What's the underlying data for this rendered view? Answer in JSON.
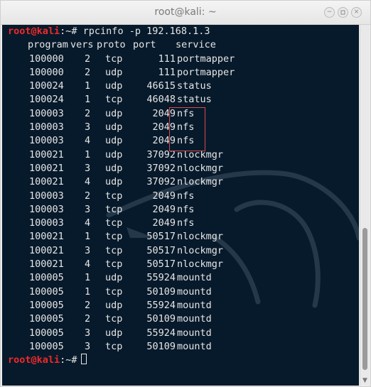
{
  "window": {
    "title": "root@kali: ~",
    "minimize_glyph": "−",
    "close_glyph": "×"
  },
  "terminal": {
    "prompt_user": "root@kali",
    "prompt_suffix": ":~# ",
    "command": "rpcinfo -p 192.168.1.3",
    "header": {
      "program": "program",
      "vers": "vers",
      "proto": "proto",
      "port": "port",
      "service": "service"
    },
    "rows": [
      [
        "100000",
        "2",
        "tcp",
        "111",
        "portmapper"
      ],
      [
        "100000",
        "2",
        "udp",
        "111",
        "portmapper"
      ],
      [
        "100024",
        "1",
        "udp",
        "46615",
        "status"
      ],
      [
        "100024",
        "1",
        "tcp",
        "46048",
        "status"
      ],
      [
        "100003",
        "2",
        "udp",
        "2049",
        "nfs"
      ],
      [
        "100003",
        "3",
        "udp",
        "2049",
        "nfs"
      ],
      [
        "100003",
        "4",
        "udp",
        "2049",
        "nfs"
      ],
      [
        "100021",
        "1",
        "udp",
        "37092",
        "nlockmgr"
      ],
      [
        "100021",
        "3",
        "udp",
        "37092",
        "nlockmgr"
      ],
      [
        "100021",
        "4",
        "udp",
        "37092",
        "nlockmgr"
      ],
      [
        "100003",
        "2",
        "tcp",
        "2049",
        "nfs"
      ],
      [
        "100003",
        "3",
        "tcp",
        "2049",
        "nfs"
      ],
      [
        "100003",
        "4",
        "tcp",
        "2049",
        "nfs"
      ],
      [
        "100021",
        "1",
        "tcp",
        "50517",
        "nlockmgr"
      ],
      [
        "100021",
        "3",
        "tcp",
        "50517",
        "nlockmgr"
      ],
      [
        "100021",
        "4",
        "tcp",
        "50517",
        "nlockmgr"
      ],
      [
        "100005",
        "1",
        "udp",
        "55924",
        "mountd"
      ],
      [
        "100005",
        "1",
        "tcp",
        "50109",
        "mountd"
      ],
      [
        "100005",
        "2",
        "udp",
        "55924",
        "mountd"
      ],
      [
        "100005",
        "2",
        "tcp",
        "50109",
        "mountd"
      ],
      [
        "100005",
        "3",
        "udp",
        "55924",
        "mountd"
      ],
      [
        "100005",
        "3",
        "tcp",
        "50109",
        "mountd"
      ]
    ]
  },
  "colors": {
    "terminal_bg": "#071a2b",
    "prompt_user": "#ef2929",
    "text": "#e6e6e6",
    "highlight_box": "#d84949"
  }
}
